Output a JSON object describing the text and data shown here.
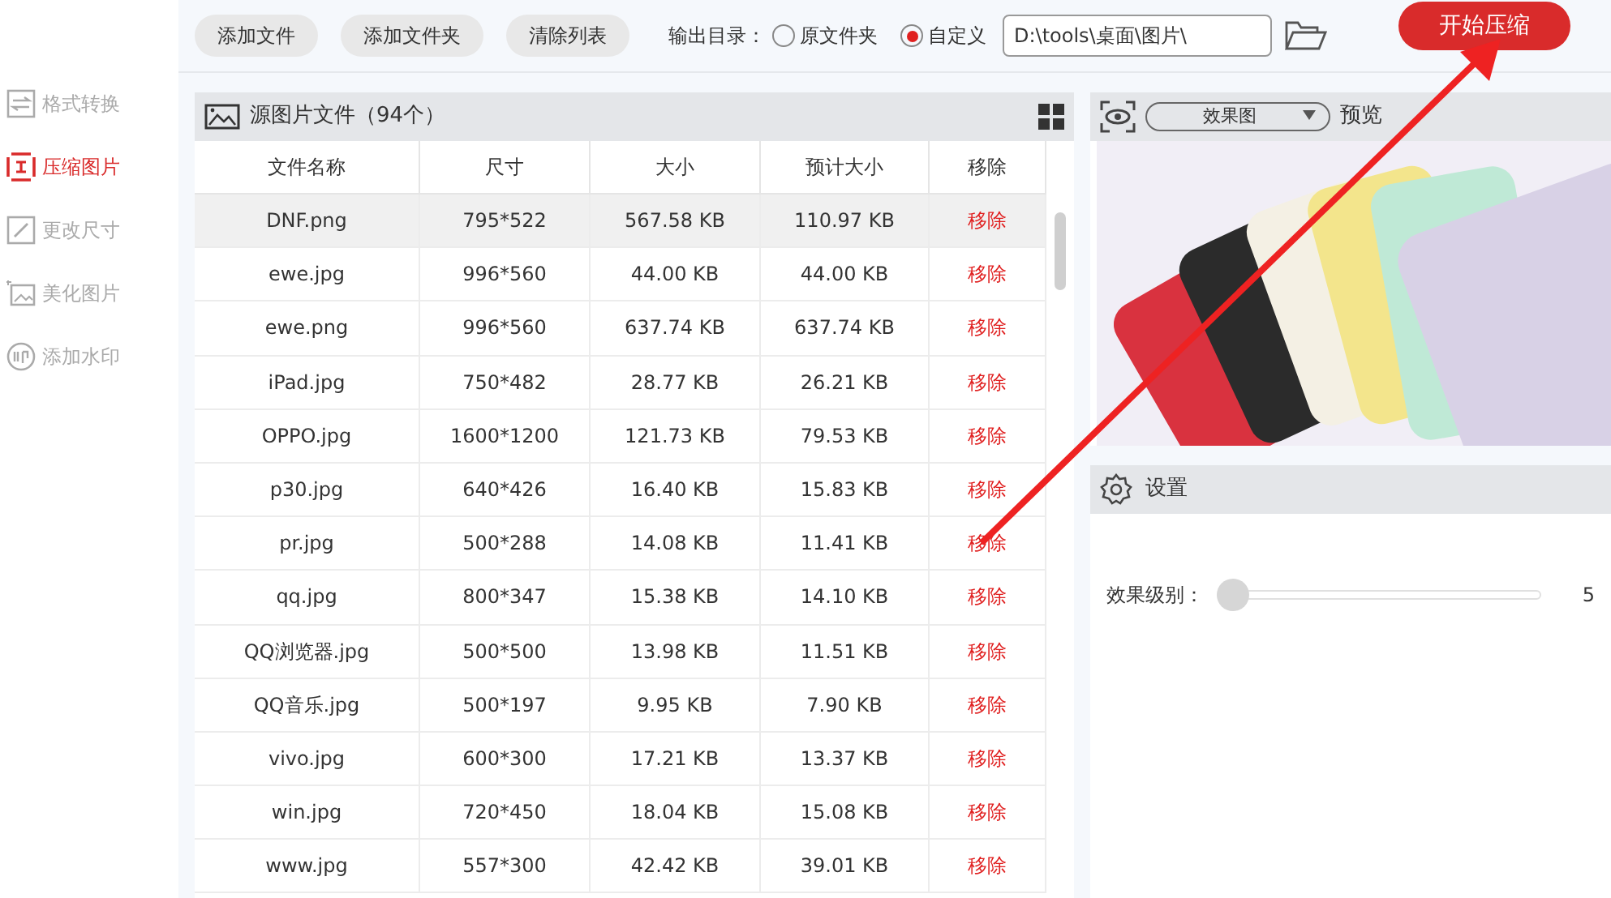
{
  "toolbar": {
    "buttons": [
      "添加文件",
      "添加文件夹",
      "清除列表"
    ],
    "output_label": "输出目录：",
    "radios": [
      {
        "label": "原文件夹",
        "selected": false
      },
      {
        "label": "自定义",
        "selected": true
      }
    ],
    "path": "D:\\tools\\桌面\\图片\\",
    "start_button": "开始压缩"
  },
  "sidebar": {
    "items": [
      {
        "label": "格式转换",
        "selected": false
      },
      {
        "label": "压缩图片",
        "selected": true
      },
      {
        "label": "更改尺寸",
        "selected": false
      },
      {
        "label": "美化图片",
        "selected": false
      },
      {
        "label": "添加水印",
        "selected": false
      }
    ]
  },
  "file_panel": {
    "title": "源图片文件（94个）",
    "columns": [
      "文件名称",
      "尺寸",
      "大小",
      "预计大小",
      "移除"
    ],
    "rows": [
      {
        "cells": [
          "DNF.png",
          "795*522",
          "567.58 KB",
          "110.97 KB",
          "移除"
        ],
        "selected": true
      },
      {
        "cells": [
          "ewe.jpg",
          "996*560",
          "44.00 KB",
          "44.00 KB",
          "移除"
        ],
        "selected": false
      },
      {
        "cells": [
          "ewe.png",
          "996*560",
          "637.74 KB",
          "637.74 KB",
          "移除"
        ],
        "selected": false
      },
      {
        "cells": [
          "iPad.jpg",
          "750*482",
          "28.77 KB",
          "26.21 KB",
          "移除"
        ],
        "selected": false
      },
      {
        "cells": [
          "OPPO.jpg",
          "1600*1200",
          "121.73 KB",
          "79.53 KB",
          "移除"
        ],
        "selected": false
      },
      {
        "cells": [
          "p30.jpg",
          "640*426",
          "16.40 KB",
          "15.83 KB",
          "移除"
        ],
        "selected": false
      },
      {
        "cells": [
          "pr.jpg",
          "500*288",
          "14.08 KB",
          "11.41 KB",
          "移除"
        ],
        "selected": false
      },
      {
        "cells": [
          "qq.jpg",
          "800*347",
          "15.38 KB",
          "14.10 KB",
          "移除"
        ],
        "selected": false
      },
      {
        "cells": [
          "QQ浏览器.jpg",
          "500*500",
          "13.98 KB",
          "11.51 KB",
          "移除"
        ],
        "selected": false
      },
      {
        "cells": [
          "QQ音乐.jpg",
          "500*197",
          "9.95 KB",
          "7.90 KB",
          "移除"
        ],
        "selected": false
      },
      {
        "cells": [
          "vivo.jpg",
          "600*300",
          "17.21 KB",
          "13.37 KB",
          "移除"
        ],
        "selected": false
      },
      {
        "cells": [
          "win.jpg",
          "720*450",
          "18.04 KB",
          "15.08 KB",
          "移除"
        ],
        "selected": false
      },
      {
        "cells": [
          "www.jpg",
          "557*300",
          "42.42 KB",
          "39.01 KB",
          "移除"
        ],
        "selected": false
      }
    ]
  },
  "preview": {
    "dropdown": "效果图",
    "label": "预览"
  },
  "settings": {
    "title": "设置",
    "label": "效果级别：",
    "level": 0.0,
    "value": "5"
  }
}
